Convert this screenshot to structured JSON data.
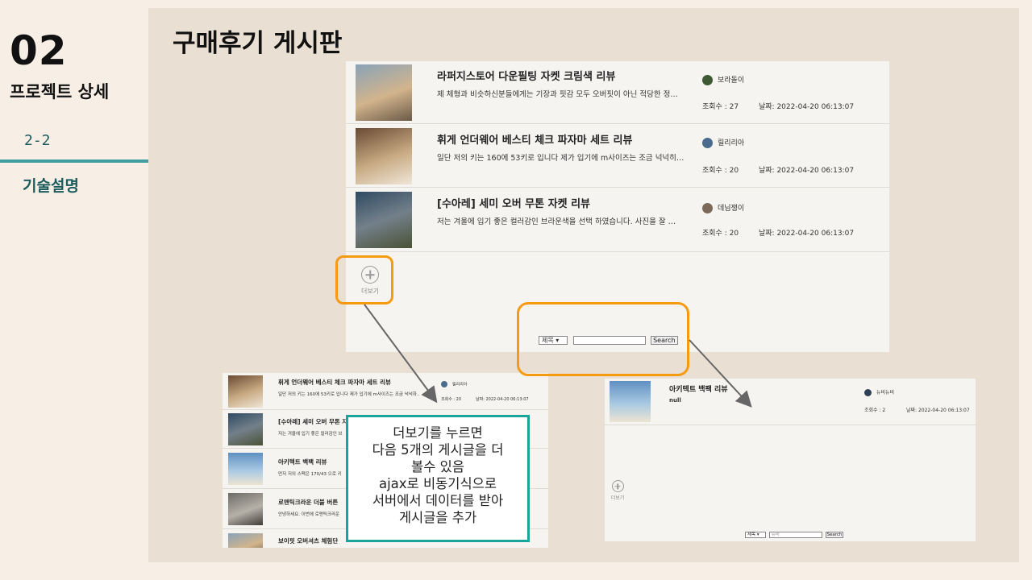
{
  "slide": {
    "number": "02",
    "subtitle": "프로젝트 상세",
    "section": "2-2",
    "section_label": "기술설명",
    "heading": "구매후기 게시판"
  },
  "main_list": {
    "posts": [
      {
        "title": "라퍼지스토어 다운필팅 자켓 크림색 리뷰",
        "body": "제 체형과 비슷하신분들에게는 기장과 핏감 모두 오버핏이 아닌 적당한 정…",
        "author": "보라돌이",
        "views": "조회수 : 27",
        "date": "날짜: 2022-04-20 06:13:07"
      },
      {
        "title": "휘게 언더웨어 베스티 체크 파자마 세트 리뷰",
        "body": "일단 저의 키는 160에 53키로 입니다 제가 입기에 m사이즈는 조금 넉넉히…",
        "author": "릴리리아",
        "views": "조회수 : 20",
        "date": "날짜: 2022-04-20 06:13:07"
      },
      {
        "title": "[수아레] 세미 오버 무톤 자켓 리뷰",
        "body": "저는 겨울에 입기 좋은 컬러감인 브라운색을 선택 하였습니다. 사진을 잘 …",
        "author": "데님쟁이",
        "views": "조회수 : 20",
        "date": "날짜: 2022-04-20 06:13:07"
      }
    ],
    "more_label": "더보기",
    "search": {
      "select": "제목",
      "button": "Search"
    }
  },
  "expanded_list": {
    "posts": [
      {
        "title": "휘게 언더웨어 베스티 체크 파자마 세트 리뷰",
        "body": "일단 저의 키는 160에 53키로 입니다 제가 입기에 m사이즈는 조금 넉넉하…",
        "author": "릴리리아",
        "views": "조회수 : 20",
        "date": "날짜: 2022-04-20 06:13:07"
      },
      {
        "title": "[수아레] 세미 오버 무톤 자",
        "body": "저는 겨울에 입기 좋은 컬러감인 브"
      },
      {
        "title": "아키텍트 백팩 리뷰",
        "body": "먼저 저의 스펙은 170/43 으로 키"
      },
      {
        "title": "로맨틱크라운 더블 버튼",
        "body": "안녕하세요. 이번에 로맨틱크라운"
      },
      {
        "title": "보이핏 오버셔츠 체험단"
      }
    ]
  },
  "search_result": {
    "post": {
      "title": "아키텍트 백팩 리뷰",
      "body": "null",
      "author": "뉴비뉴비",
      "views": "조회수 : 2",
      "date": "날짜: 2022-04-20 06:13:07"
    },
    "more_label": "더보기",
    "search": {
      "select": "제목",
      "input": "뉴비",
      "button": "Search"
    }
  },
  "callout": {
    "lines": [
      "더보기를 누르면",
      "다음 5개의 게시글을 더",
      "볼수 있음",
      "ajax로 비동기식으로",
      "서버에서 데이터를 받아",
      "게시글을 추가"
    ]
  },
  "colors": {
    "accent_orange": "#f59a11",
    "accent_teal": "#18a59c",
    "section_teal": "#1c5c5c"
  }
}
